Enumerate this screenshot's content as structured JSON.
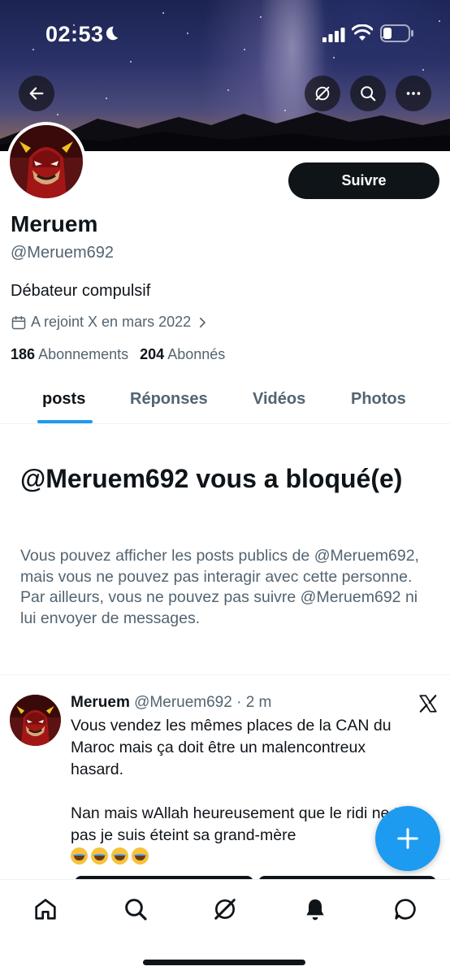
{
  "status_bar": {
    "time": "02:53"
  },
  "profile": {
    "name": "Meruem",
    "handle": "@Meruem692",
    "bio": "Débateur compulsif",
    "joined": "A rejoint X en mars 2022",
    "following_count": "186",
    "following_label": "Abonnements",
    "followers_count": "204",
    "followers_label": "Abonnés",
    "follow_label": "Suivre"
  },
  "tabs": [
    {
      "label": "posts",
      "active": true
    },
    {
      "label": "Réponses",
      "active": false
    },
    {
      "label": "Vidéos",
      "active": false
    },
    {
      "label": "Photos",
      "active": false
    }
  ],
  "blocked": {
    "title": "@Meruem692 vous a bloqué(e)",
    "text": "Vous pouvez afficher les posts publics de @Meruem692, mais vous ne pouvez pas interagir avec cette personne. Par ailleurs, vous ne pouvez pas suivre @Meruem692 ni lui envoyer de messages."
  },
  "post": {
    "name": "Meruem",
    "handle": "@Meruem692",
    "time": "· 2 m",
    "text_line_1": "Vous vendez les mêmes places de la CAN du Maroc mais ça doit être un malencontreux hasard.",
    "text_line_2": "Nan mais wAllah heureusement que le ridi ne tue pas je suis éteint sa grand-mère",
    "emoji_count": 4
  },
  "colors": {
    "accent": "#1d9bf0",
    "text_primary": "#0f1419",
    "text_secondary": "#536471"
  },
  "icons": {
    "banner": [
      "back-arrow-icon",
      "grok-icon",
      "search-icon",
      "more-icon"
    ],
    "bottom_nav": [
      "home-icon",
      "search-icon",
      "grok-icon",
      "notifications-bell-icon",
      "messages-icon"
    ]
  }
}
